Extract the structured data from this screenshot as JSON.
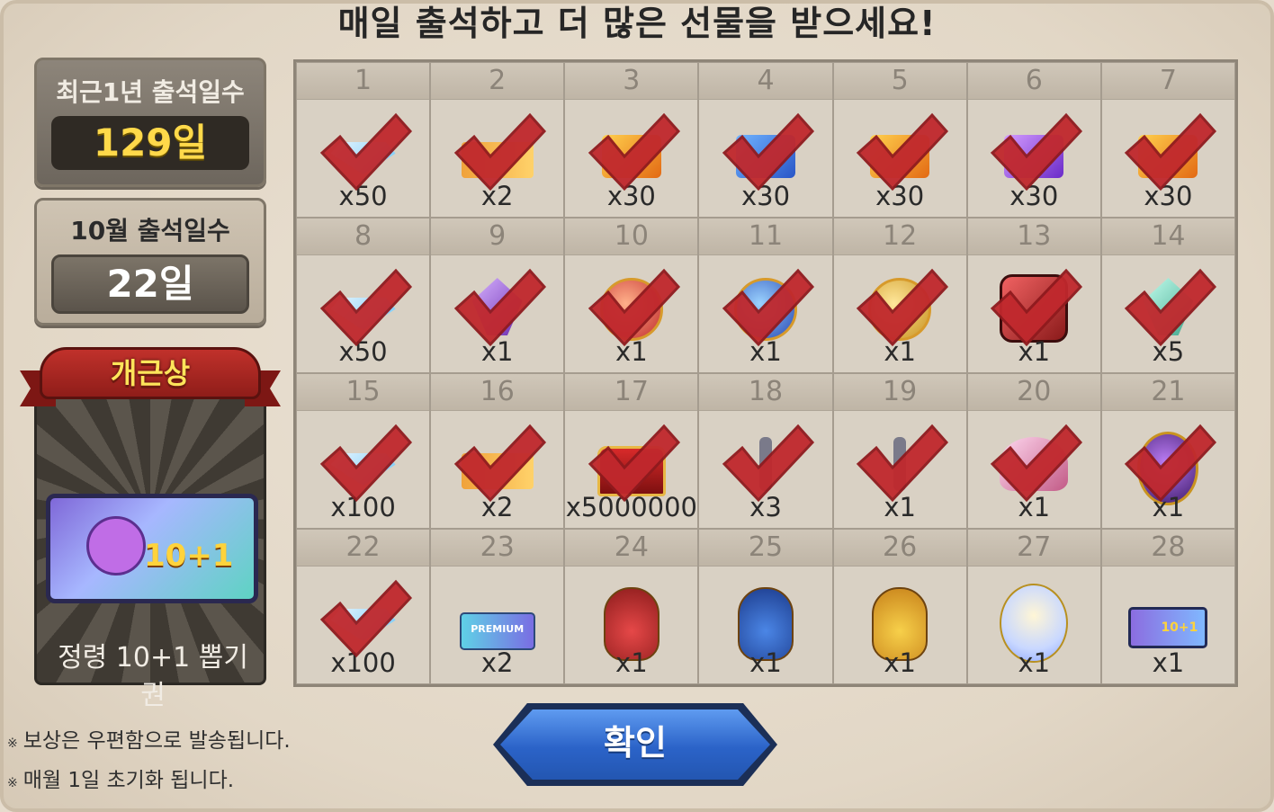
{
  "title": "매일 출석하고 더 많은 선물을 받으세요!",
  "stats": {
    "yearly_label": "최근1년 출석일수",
    "yearly_value": "129일",
    "monthly_label": "10월 출석일수",
    "monthly_value": "22일"
  },
  "award": {
    "ribbon": "개근상",
    "ticket_badge": "10+1",
    "caption_line1": "정령 10+1 뽑기",
    "caption_line2": "권"
  },
  "days": [
    {
      "day": "1",
      "qty": "x50",
      "icon": "diamond-icon",
      "checked": true
    },
    {
      "day": "2",
      "qty": "x2",
      "icon": "ticket-icon",
      "checked": true
    },
    {
      "day": "3",
      "qty": "x30",
      "icon": "card-icon",
      "checked": true
    },
    {
      "day": "4",
      "qty": "x30",
      "icon": "card-blue-icon",
      "checked": true
    },
    {
      "day": "5",
      "qty": "x30",
      "icon": "card-icon",
      "checked": true
    },
    {
      "day": "6",
      "qty": "x30",
      "icon": "card-purple-icon",
      "checked": true
    },
    {
      "day": "7",
      "qty": "x30",
      "icon": "card-icon",
      "checked": true
    },
    {
      "day": "8",
      "qty": "x50",
      "icon": "diamond-icon",
      "checked": true
    },
    {
      "day": "9",
      "qty": "x1",
      "icon": "crystal-icon",
      "checked": true
    },
    {
      "day": "10",
      "qty": "x1",
      "icon": "orb-red-icon",
      "checked": true
    },
    {
      "day": "11",
      "qty": "x1",
      "icon": "orb-blue-icon",
      "checked": true
    },
    {
      "day": "12",
      "qty": "x1",
      "icon": "orb-gold-icon",
      "checked": true
    },
    {
      "day": "13",
      "qty": "x1",
      "icon": "gem-icon",
      "checked": true
    },
    {
      "day": "14",
      "qty": "x5",
      "icon": "crystal-green-icon",
      "checked": true
    },
    {
      "day": "15",
      "qty": "x100",
      "icon": "diamond-icon",
      "checked": true
    },
    {
      "day": "16",
      "qty": "x2",
      "icon": "ticket-icon",
      "checked": true
    },
    {
      "day": "17",
      "qty": "x5000000",
      "icon": "treasure-chest-icon",
      "checked": true
    },
    {
      "day": "18",
      "qty": "x3",
      "icon": "key-icon",
      "checked": true
    },
    {
      "day": "19",
      "qty": "x1",
      "icon": "key-icon",
      "checked": true
    },
    {
      "day": "20",
      "qty": "x1",
      "icon": "wing-icon",
      "checked": true
    },
    {
      "day": "21",
      "qty": "x1",
      "icon": "egg-icon",
      "checked": true
    },
    {
      "day": "22",
      "qty": "x100",
      "icon": "diamond-icon",
      "checked": true
    },
    {
      "day": "23",
      "qty": "x2",
      "icon": "premium-ticket-icon",
      "checked": false,
      "text": "PREMIUM"
    },
    {
      "day": "24",
      "qty": "x1",
      "icon": "potion-red-icon",
      "checked": false
    },
    {
      "day": "25",
      "qty": "x1",
      "icon": "potion-blue-icon",
      "checked": false
    },
    {
      "day": "26",
      "qty": "x1",
      "icon": "potion-gold-icon",
      "checked": false
    },
    {
      "day": "27",
      "qty": "x1",
      "icon": "egg-shine-icon",
      "checked": false
    },
    {
      "day": "28",
      "qty": "x1",
      "icon": "summon-ticket-icon",
      "checked": false,
      "text": "10+1"
    }
  ],
  "notes": {
    "note1": "보상은 우편함으로 발송됩니다.",
    "note2": "매월 1일 초기화 됩니다."
  },
  "confirm_label": "확인",
  "colors": {
    "check": "#c0282d",
    "confirm_button": "#2b63c8",
    "gold_text": "#ffd94a"
  }
}
